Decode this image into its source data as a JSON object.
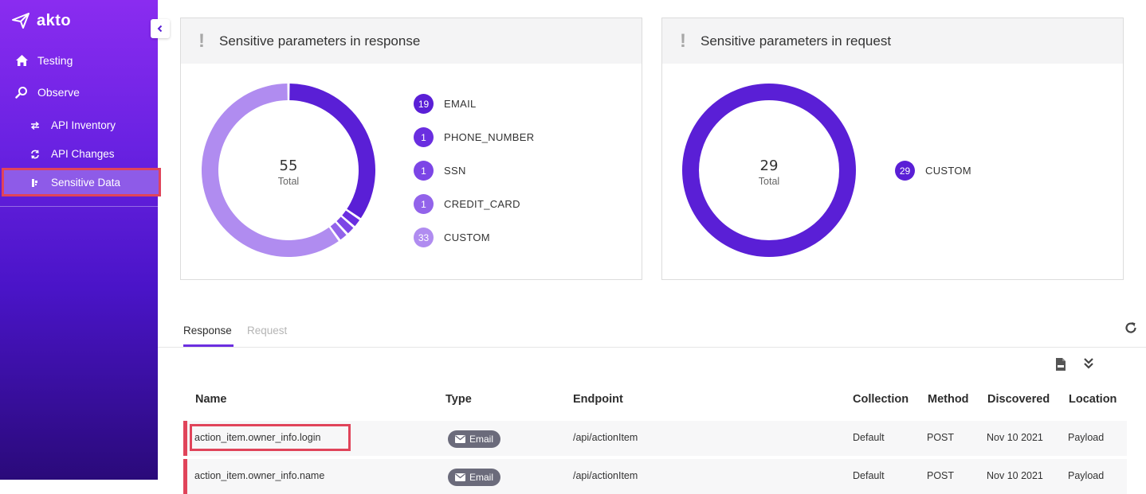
{
  "app": {
    "logo_text": "akto"
  },
  "sidebar": {
    "items": [
      {
        "label": "Testing",
        "icon": "home-icon"
      },
      {
        "label": "Observe",
        "icon": "search-icon"
      },
      {
        "label": "API Inventory",
        "icon": "swap-icon"
      },
      {
        "label": "API Changes",
        "icon": "sync-icon"
      },
      {
        "label": "Sensitive Data",
        "icon": "data-icon",
        "active": true
      }
    ]
  },
  "response_card": {
    "title": "Sensitive parameters in response",
    "total": "55",
    "total_label": "Total",
    "legend": [
      {
        "count": "19",
        "label": "EMAIL",
        "color": "#5a1fd6"
      },
      {
        "count": "1",
        "label": "PHONE_NUMBER",
        "color": "#6a2ee0"
      },
      {
        "count": "1",
        "label": "SSN",
        "color": "#7c45e6"
      },
      {
        "count": "1",
        "label": "CREDIT_CARD",
        "color": "#9263ea"
      },
      {
        "count": "33",
        "label": "CUSTOM",
        "color": "#b08cf0"
      }
    ]
  },
  "request_card": {
    "title": "Sensitive parameters in request",
    "total": "29",
    "total_label": "Total",
    "legend": [
      {
        "count": "29",
        "label": "CUSTOM",
        "color": "#5a1fd6"
      }
    ]
  },
  "tabs": {
    "active": "Response",
    "inactive": "Request"
  },
  "table": {
    "headers": {
      "name": "Name",
      "type": "Type",
      "endpoint": "Endpoint",
      "collection": "Collection",
      "method": "Method",
      "discovered": "Discovered",
      "location": "Location"
    },
    "rows": [
      {
        "name": "action_item.owner_info.login",
        "type": "Email",
        "endpoint": "/api/actionItem",
        "collection": "Default",
        "method": "POST",
        "discovered": "Nov 10 2021",
        "location": "Payload"
      },
      {
        "name": "action_item.owner_info.name",
        "type": "Email",
        "endpoint": "/api/actionItem",
        "collection": "Default",
        "method": "POST",
        "discovered": "Nov 10 2021",
        "location": "Payload"
      }
    ]
  },
  "colors": {
    "accent": "#6c2ee0",
    "highlight": "#e0445a",
    "donut_primary": "#5a1fd6",
    "donut_custom": "#b08cf0"
  }
}
